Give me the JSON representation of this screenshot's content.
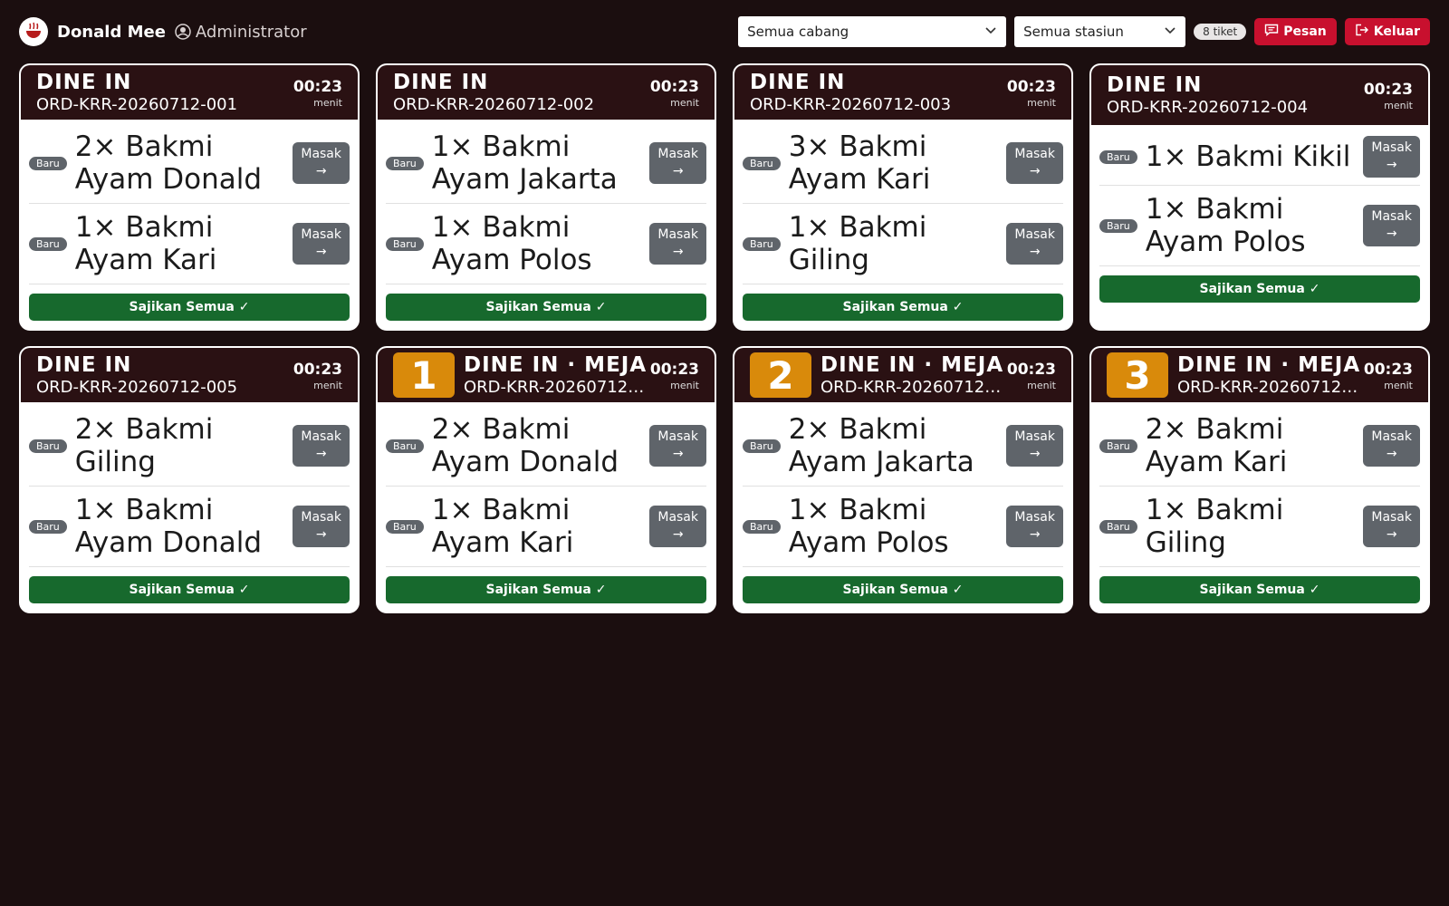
{
  "header": {
    "brand": "Donald Mee",
    "role": "Administrator",
    "branch_select": "Semua cabang",
    "station_select": "Semua stasiun",
    "ticket_count": "8 tiket",
    "message_button": "Pesan",
    "logout_button": "Keluar"
  },
  "tickets": [
    {
      "order_type": "DINE IN",
      "order_id": "ORD-KRR-20260712-001",
      "table": "",
      "timer": "00:23",
      "timer_unit": "menit",
      "items": [
        {
          "status": "Baru",
          "name": "2× Bakmi Ayam Donald",
          "action": "Masak →"
        },
        {
          "status": "Baru",
          "name": "1× Bakmi Ayam Kari",
          "action": "Masak →"
        }
      ],
      "serve_all": "Sajikan Semua ✓"
    },
    {
      "order_type": "DINE IN",
      "order_id": "ORD-KRR-20260712-002",
      "table": "",
      "timer": "00:23",
      "timer_unit": "menit",
      "items": [
        {
          "status": "Baru",
          "name": "1× Bakmi Ayam Jakarta",
          "action": "Masak →"
        },
        {
          "status": "Baru",
          "name": "1× Bakmi Ayam Polos",
          "action": "Masak →"
        }
      ],
      "serve_all": "Sajikan Semua ✓"
    },
    {
      "order_type": "DINE IN",
      "order_id": "ORD-KRR-20260712-003",
      "table": "",
      "timer": "00:23",
      "timer_unit": "menit",
      "items": [
        {
          "status": "Baru",
          "name": "3× Bakmi Ayam Kari",
          "action": "Masak →"
        },
        {
          "status": "Baru",
          "name": "1× Bakmi Giling",
          "action": "Masak →"
        }
      ],
      "serve_all": "Sajikan Semua ✓"
    },
    {
      "order_type": "DINE IN",
      "order_id": "ORD-KRR-20260712-004",
      "table": "",
      "timer": "00:23",
      "timer_unit": "menit",
      "items": [
        {
          "status": "Baru",
          "name": "1× Bakmi Kikil",
          "action": "Masak →"
        },
        {
          "status": "Baru",
          "name": "1× Bakmi Ayam Polos",
          "action": "Masak →"
        }
      ],
      "serve_all": "Sajikan Semua ✓"
    },
    {
      "order_type": "DINE IN",
      "order_id": "ORD-KRR-20260712-005",
      "table": "",
      "timer": "00:23",
      "timer_unit": "menit",
      "items": [
        {
          "status": "Baru",
          "name": "2× Bakmi Giling",
          "action": "Masak →"
        },
        {
          "status": "Baru",
          "name": "1× Bakmi Ayam Donald",
          "action": "Masak →"
        }
      ],
      "serve_all": "Sajikan Semua ✓"
    },
    {
      "order_type": "DINE IN · MEJA",
      "order_id": "ORD-KRR-20260712-...",
      "table": "1",
      "timer": "00:23",
      "timer_unit": "menit",
      "items": [
        {
          "status": "Baru",
          "name": "2× Bakmi Ayam Donald",
          "action": "Masak →"
        },
        {
          "status": "Baru",
          "name": "1× Bakmi Ayam Kari",
          "action": "Masak →"
        }
      ],
      "serve_all": "Sajikan Semua ✓"
    },
    {
      "order_type": "DINE IN · MEJA",
      "order_id": "ORD-KRR-20260712-...",
      "table": "2",
      "timer": "00:23",
      "timer_unit": "menit",
      "items": [
        {
          "status": "Baru",
          "name": "2× Bakmi Ayam Jakarta",
          "action": "Masak →"
        },
        {
          "status": "Baru",
          "name": "1× Bakmi Ayam Polos",
          "action": "Masak →"
        }
      ],
      "serve_all": "Sajikan Semua ✓"
    },
    {
      "order_type": "DINE IN · MEJA",
      "order_id": "ORD-KRR-20260712-...",
      "table": "3",
      "timer": "00:23",
      "timer_unit": "menit",
      "items": [
        {
          "status": "Baru",
          "name": "2× Bakmi Ayam Kari",
          "action": "Masak →"
        },
        {
          "status": "Baru",
          "name": "1× Bakmi Giling",
          "action": "Masak →"
        }
      ],
      "serve_all": "Sajikan Semua ✓"
    }
  ]
}
